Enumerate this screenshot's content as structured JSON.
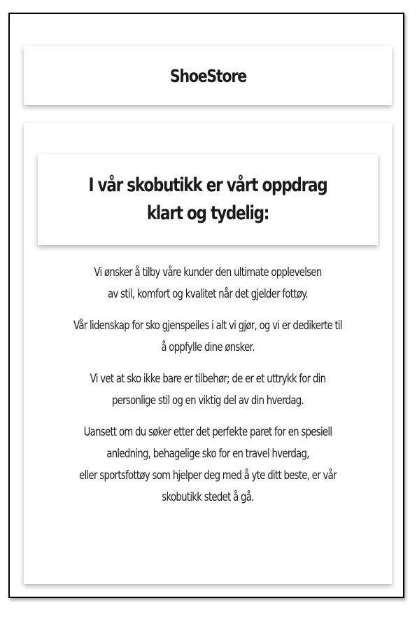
{
  "header": {
    "title": "ShoeStore"
  },
  "mission": {
    "heading": "I vår skobutikk er vårt oppdrag klart og tydelig:",
    "paragraphs": [
      {
        "text": "Vi ønsker å tilby våre kunder den ultimate opplevelsen av stil, komfort og kvalitet når det gjelder fottøy."
      },
      {
        "text": "Vår lidenskap for sko gjenspeiles i alt vi gjør, og vi er dedikerte til å oppfylle dine ønsker."
      },
      {
        "text": "Vi vet at sko ikke bare er tilbehør; de er et uttrykk for din personlige stil og en viktig del av din hverdag."
      },
      {
        "line1": "Uansett om du søker etter det perfekte paret for en spesiell anledning, behagelige sko for en travel hverdag,",
        "line2": "eller sportsfottøy som hjelper deg med å yte ditt beste, er vår skobutikk stedet å gå."
      }
    ]
  },
  "colors": {
    "text": "#1a1a1a",
    "background": "#ffffff",
    "border": "#000000"
  }
}
